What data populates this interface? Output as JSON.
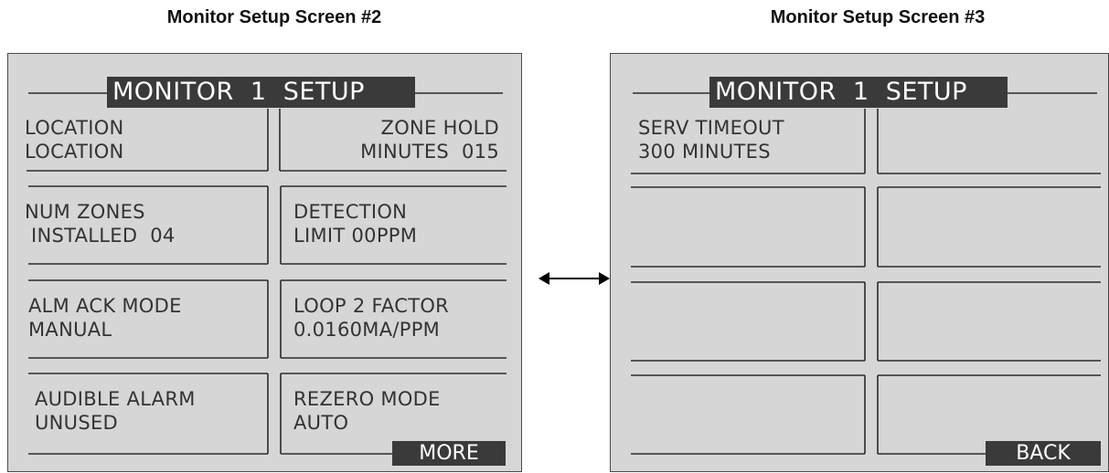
{
  "captions": {
    "left": "Monitor Setup Screen #2",
    "right": "Monitor Setup Screen #3"
  },
  "screen2": {
    "title": "MONITOR  1  SETUP",
    "cells": {
      "location": [
        "LOCATION",
        "LOCATION"
      ],
      "zone_hold": [
        "ZONE HOLD",
        "MINUTES  015"
      ],
      "num_zones": [
        "NUM ZONES",
        " INSTALLED  04"
      ],
      "detection": [
        "DETECTION",
        "LIMIT 00PPM"
      ],
      "alm_ack": [
        "ALM ACK MODE",
        "MANUAL"
      ],
      "loop2": [
        "LOOP 2 FACTOR",
        "0.0160MA/PPM"
      ],
      "audible": [
        " AUDIBLE ALARM",
        " UNUSED"
      ],
      "rezero": [
        "REZERO MODE",
        "AUTO"
      ]
    },
    "more_label": "MORE"
  },
  "screen3": {
    "title": "MONITOR  1  SETUP",
    "cells": {
      "serv_timeout": [
        "SERV TIMEOUT",
        "300 MINUTES"
      ]
    },
    "back_label": "BACK"
  },
  "navigation_arrow": "bidirectional-arrow-icon"
}
